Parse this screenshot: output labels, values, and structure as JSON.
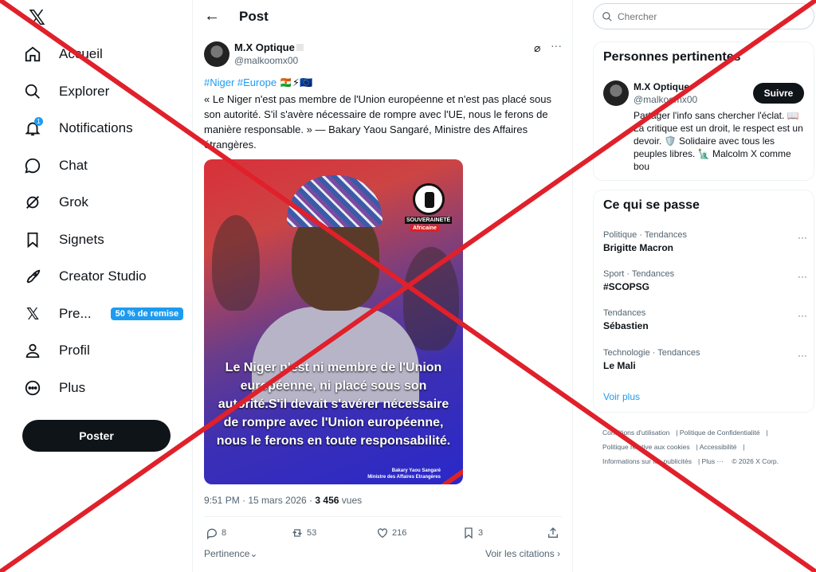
{
  "sidebar": {
    "logo": "𝕏",
    "items": [
      {
        "label": "Accueil"
      },
      {
        "label": "Explorer"
      },
      {
        "label": "Notifications",
        "badge": "1"
      },
      {
        "label": "Chat"
      },
      {
        "label": "Grok"
      },
      {
        "label": "Signets"
      },
      {
        "label": "Creator Studio"
      },
      {
        "label": "Pre...",
        "promo": "50 % de remise"
      },
      {
        "label": "Profil"
      },
      {
        "label": "Plus"
      }
    ],
    "post_button": "Poster"
  },
  "header": {
    "title": "Post"
  },
  "post": {
    "author_name": "M.X Optique",
    "author_handle": "@malkoomx00",
    "tags": "#Niger #Europe",
    "tag_flags": "🇳🇪⚡🇪🇺",
    "text": "« Le Niger n'est pas membre de l'Union européenne et n'est pas placé sous son autorité. S'il s'avère nécessaire de rompre avec l'UE, nous le ferons de manière responsable. » — Bakary Yaou Sangaré, Ministre des Affaires étrangères.",
    "image": {
      "logo_line1": "SOUVERAINETÉ",
      "logo_line2": "Africaine",
      "quote": "Le Niger n'est ni membre de l'Union européenne, ni placé sous son autorité.S'il devait s'avérer nécessaire de rompre avec l'Union européenne, nous le ferons en toute responsabilité.",
      "signature_name": "Bakary Yaou Sangaré",
      "signature_title": "Ministre des Affaires Etrangères"
    },
    "time": "9:51 PM · 15 mars 2026 · ",
    "views_count": "3 456",
    "views_label": " vues",
    "replies": "8",
    "reposts": "53",
    "likes": "216",
    "bookmarks": "3",
    "sort_label": "Pertinence",
    "quotes_link": "Voir les citations"
  },
  "right": {
    "search_placeholder": "Chercher",
    "relevant_title": "Personnes pertinentes",
    "relevant_person": {
      "name": "M.X Optique",
      "handle": "@malkoomx00",
      "follow": "Suivre",
      "bio": "Partager l'info sans chercher l'éclat. 📖 La critique est un droit, le respect est un devoir. 🛡️ Solidaire avec tous les peuples libres. 🗽 Malcolm X comme bou"
    },
    "trends_title": "Ce qui se passe",
    "trends": [
      {
        "category": "Politique · Tendances",
        "name": "Brigitte Macron"
      },
      {
        "category": "Sport · Tendances",
        "name": "#SCOPSG"
      },
      {
        "category": "Tendances",
        "name": "Sébastien"
      },
      {
        "category": "Technologie · Tendances",
        "name": "Le Mali"
      }
    ],
    "see_more": "Voir plus",
    "footer": {
      "terms": "Conditions d'utilisation",
      "privacy": "Politique de Confidentialité",
      "cookies": "Politique relative aux cookies",
      "accessibility": "Accessibilité",
      "ads": "Informations sur les publicités",
      "more": "Plus ···",
      "copyright": "© 2026 X Corp."
    }
  },
  "overlay": {
    "color": "#e0202a"
  }
}
